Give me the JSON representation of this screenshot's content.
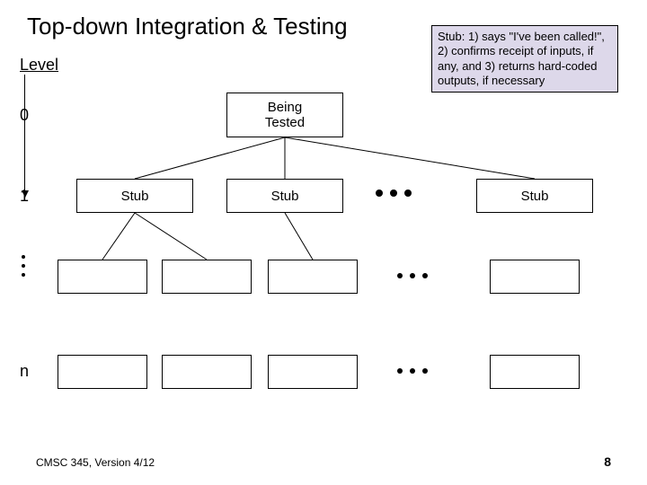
{
  "title": "Top-down Integration & Testing",
  "level_label": "Level",
  "levels": {
    "l0": "0",
    "l1": "1",
    "ln": "n"
  },
  "boxes": {
    "being_tested": "Being\nTested",
    "stub": "Stub"
  },
  "callout": "Stub: 1) says \"I've been called!\", 2) confirms receipt of inputs, if any, and 3) returns hard-coded outputs, if necessary",
  "footer": {
    "left": "CMSC 345, Version 4/12",
    "page": "8"
  },
  "chart_data": {
    "type": "diagram",
    "title": "Top-down Integration & Testing",
    "description": "Tree of module levels. Level 0 root is the module Being Tested. Level 1 children are Stubs. Lower levels (… through n) are empty placeholder modules. Horizontal ellipsis (…) at each level indicates additional siblings.",
    "levels": [
      {
        "level": "0",
        "nodes": [
          "Being Tested"
        ]
      },
      {
        "level": "1",
        "nodes": [
          "Stub",
          "Stub",
          "…",
          "Stub"
        ]
      },
      {
        "level": "…",
        "nodes": [
          "",
          "",
          "",
          "…",
          ""
        ]
      },
      {
        "level": "n",
        "nodes": [
          "",
          "",
          "",
          "…",
          ""
        ]
      }
    ],
    "callout": "Stub: 1) says \"I've been called!\", 2) confirms receipt of inputs, if any, and 3) returns hard-coded outputs, if necessary"
  }
}
